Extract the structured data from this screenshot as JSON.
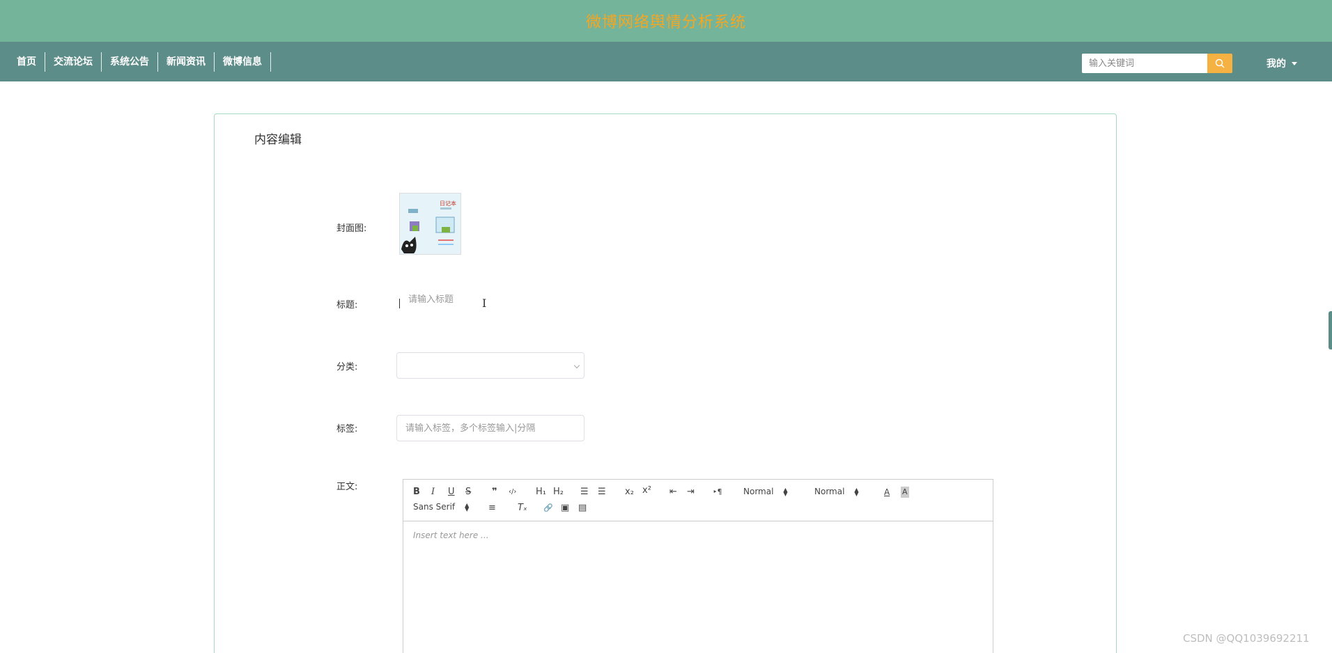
{
  "app": {
    "title": "微博网络舆情分析系统"
  },
  "nav": {
    "items": [
      {
        "label": "首页"
      },
      {
        "label": "交流论坛"
      },
      {
        "label": "系统公告"
      },
      {
        "label": "新闻资讯"
      },
      {
        "label": "微博信息"
      }
    ],
    "search_placeholder": "输入关键词",
    "mine_label": "我的"
  },
  "card": {
    "title": "内容编辑",
    "fields": {
      "cover_label": "封面图:",
      "title_label": "标题:",
      "title_placeholder": "请输入标题",
      "category_label": "分类:",
      "category_value": "",
      "tags_label": "标签:",
      "tags_placeholder": "请输入标签，多个标签输入|分隔",
      "body_label": "正文:"
    }
  },
  "editor": {
    "placeholder": "Insert text here ...",
    "header_picker": "Normal",
    "size_picker": "Normal",
    "font_picker": "Sans Serif",
    "buttons": {
      "bold": "B",
      "italic": "I",
      "underline": "U",
      "strike": "S",
      "blockquote": "❞",
      "code": "‹/›",
      "h1": "H₁",
      "h2": "H₂",
      "ordered_list": "☰",
      "bullet_list": "☰",
      "subscript": "x₂",
      "superscript": "x²",
      "outdent": "⇤",
      "indent": "⇥",
      "direction": "‣¶",
      "color": "A",
      "background": "A",
      "align": "≡",
      "clean": "Tₓ",
      "link": "🔗",
      "image": "▣",
      "video": "▤"
    }
  },
  "watermark": "CSDN @QQ1039692211",
  "colors": {
    "topbar": "#74b49b",
    "navbar": "#5c8d89",
    "accent": "#f5a623",
    "search_button": "#f5b142"
  },
  "icons": {
    "search": "search-icon",
    "dropdown": "caret-down-icon",
    "select": "chevron-down-icon"
  }
}
